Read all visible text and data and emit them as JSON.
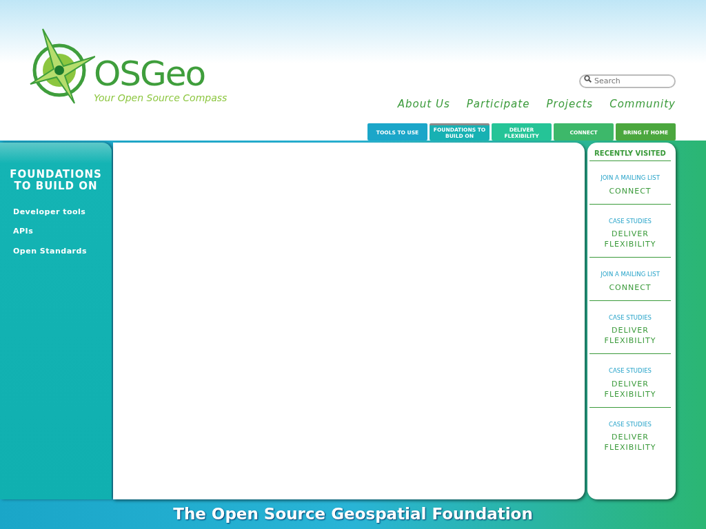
{
  "logo": {
    "name": "OSGeo",
    "tagline": "Your Open Source Compass"
  },
  "search": {
    "placeholder": "Search"
  },
  "nav_links": [
    "About Us",
    "Participate",
    "Projects",
    "Community"
  ],
  "tabs": [
    {
      "label": "TOOLS TO USE",
      "selected": false,
      "color": "#1ba6c9"
    },
    {
      "label": "FOUNDATIONS TO BUILD ON",
      "selected": true,
      "color": "#17b1b3"
    },
    {
      "label": "DELIVER FLEXIBILITY",
      "selected": false,
      "color": "#25c497"
    },
    {
      "label": "CONNECT",
      "selected": false,
      "color": "#3db86a"
    },
    {
      "label": "BRING IT HOME",
      "selected": false,
      "color": "#4ba73e"
    }
  ],
  "sidebar": {
    "title": "FOUNDATIONS TO BUILD ON",
    "items": [
      "Developer tools",
      "APIs",
      "Open Standards"
    ]
  },
  "recently_visited": {
    "title": "RECENTLY VISITED",
    "items": [
      {
        "category": "JOIN A MAILING LIST",
        "link": "CONNECT"
      },
      {
        "category": "CASE STUDIES",
        "link": "DELIVER FLEXIBILITY"
      },
      {
        "category": "JOIN A MAILING LIST",
        "link": "CONNECT"
      },
      {
        "category": "CASE STUDIES",
        "link": "DELIVER FLEXIBILITY"
      },
      {
        "category": "CASE STUDIES",
        "link": "DELIVER FLEXIBILITY"
      },
      {
        "category": "CASE STUDIES",
        "link": "DELIVER FLEXIBILITY"
      }
    ]
  },
  "footer": {
    "text": "The Open Source Geospatial Foundation"
  }
}
